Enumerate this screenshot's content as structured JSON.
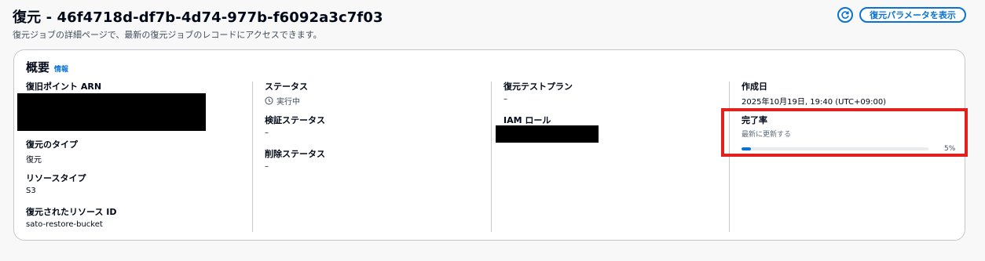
{
  "page": {
    "title": "復元 - 46f4718d-df7b-4d74-977b-f6092a3c7f03",
    "description": "復元ジョブの詳細ページで、最新の復元ジョブのレコードにアクセスできます。",
    "refresh_icon": "refresh-icon",
    "params_button": "復元パラメータを表示"
  },
  "overview": {
    "title": "概要",
    "info_link": "情報",
    "col1": {
      "recovery_point_label": "復旧ポイント ARN",
      "restore_type_label": "復元のタイプ",
      "restore_type_value": "復元",
      "resource_type_label": "リソースタイプ",
      "resource_type_value": "S3",
      "restored_resource_label": "復元されたリソース ID",
      "restored_resource_value": "sato-restore-bucket"
    },
    "col2": {
      "status_label": "ステータス",
      "status_value": "実行中",
      "status_icon": "clock-icon",
      "validation_label": "検証ステータス",
      "validation_value": "–",
      "deletion_label": "削除ステータス",
      "deletion_value": "–"
    },
    "col3": {
      "test_plan_label": "復元テストプラン",
      "test_plan_value": "–",
      "iam_role_label": "IAM ロール"
    },
    "col4": {
      "created_label": "作成日",
      "created_value": "2025年10月19日, 19:40 (UTC+09:00)",
      "completion_label": "完了率",
      "completion_hint": "最新に更新する",
      "completion_percent_text": "5%",
      "completion_fraction": 0.05
    }
  },
  "colors": {
    "accent": "#0972d3",
    "highlight": "#e3211c"
  }
}
